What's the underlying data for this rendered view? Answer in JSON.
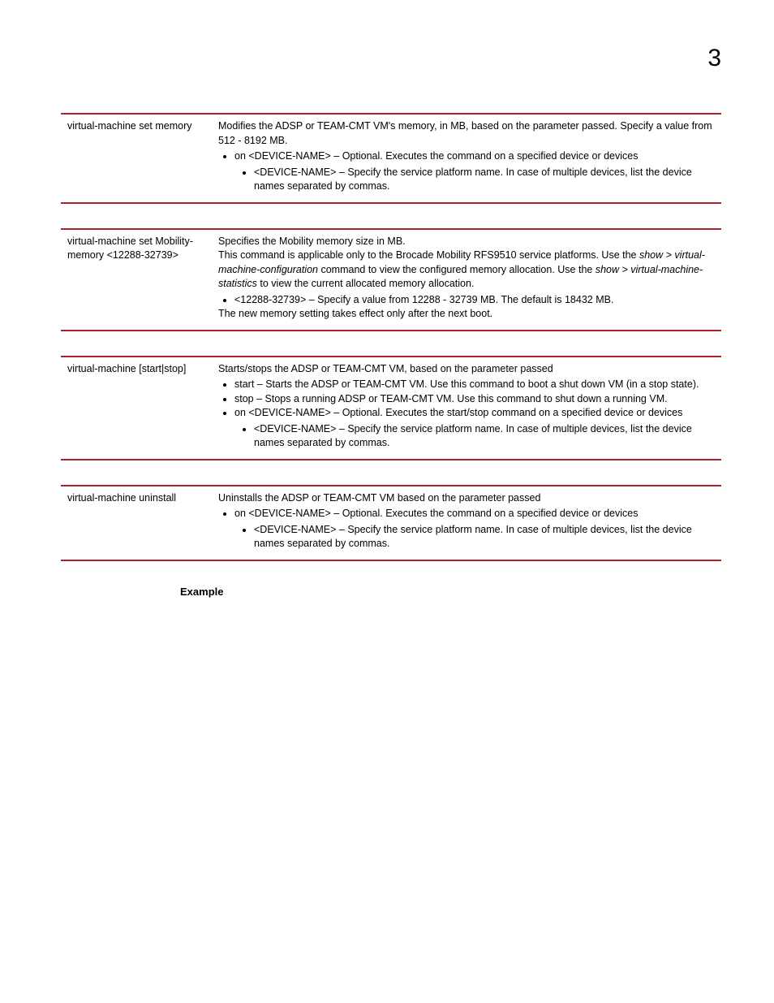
{
  "pageNumber": "3",
  "blocks": [
    {
      "left": "virtual-machine set memory",
      "intro": "Modifies the ADSP or TEAM-CMT VM's memory, in MB, based on the parameter passed. Specify a value from 512 - 8192 MB.",
      "b1": "on <DEVICE-NAME> – Optional. Executes the command on a specified device or devices",
      "b1s1": "<DEVICE-NAME> – Specify the service platform name. In case of multiple devices, list the device names separated by commas."
    },
    {
      "left": "virtual-machine set Mobility-memory <12288-32739>",
      "intro1": "Specifies the Mobility memory size in MB.",
      "intro2a": "This command is applicable only to the Brocade Mobility RFS9510 service platforms. Use the ",
      "intro2b_i": "show > virtual-machine-configuration",
      "intro2c": " command to view the configured memory allocation. Use the ",
      "intro2d_i": "show > virtual-machine-statistics",
      "intro2e": " to view the current allocated memory allocation.",
      "b1": "<12288-32739> – Specify a value from 12288 - 32739 MB. The default is 18432 MB.",
      "outro": "The new memory setting takes effect only after the next boot."
    },
    {
      "left": "virtual-machine [start|stop]",
      "intro": "Starts/stops the ADSP or TEAM-CMT VM, based on the parameter passed",
      "b1": "start – Starts the ADSP or TEAM-CMT VM. Use this command to boot a shut down VM (in a stop state).",
      "b2": "stop – Stops a running ADSP or TEAM-CMT VM. Use this command to shut down a running VM.",
      "b3": "on <DEVICE-NAME> – Optional. Executes the start/stop command on a specified device or devices",
      "b3s1": "<DEVICE-NAME> – Specify the service platform name. In case of multiple devices, list the device names separated by commas."
    },
    {
      "left": "virtual-machine uninstall",
      "intro": "Uninstalls the ADSP or TEAM-CMT VM based on the parameter passed",
      "b1": "on <DEVICE-NAME> – Optional. Executes the command on a specified device or devices",
      "b1s1": "<DEVICE-NAME> – Specify the service platform name. In case of multiple devices, list the device names separated by commas."
    }
  ],
  "exampleLabel": "Example"
}
